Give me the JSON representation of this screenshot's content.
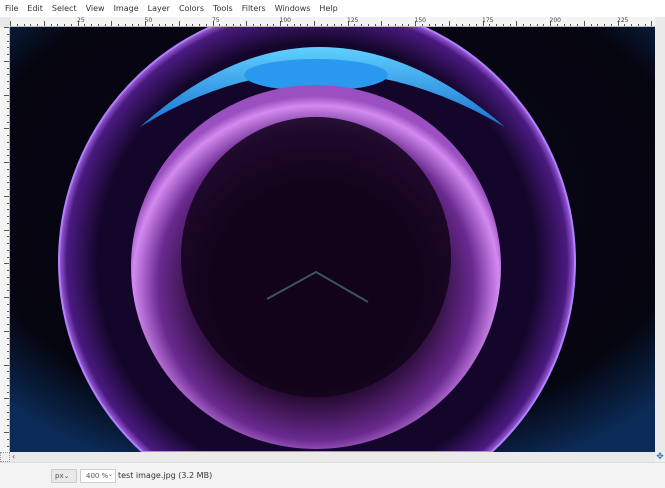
{
  "menu": [
    "File",
    "Edit",
    "Select",
    "View",
    "Image",
    "Layer",
    "Colors",
    "Tools",
    "Filters",
    "Windows",
    "Help"
  ],
  "ruler_labels": [
    "25",
    "50",
    "75",
    "100",
    "125",
    "150",
    "175",
    "200",
    "225"
  ],
  "status": {
    "unit": "px",
    "zoom": "400 %",
    "file_info": "test image.jpg (3.2 MB)"
  },
  "icons": {
    "nav": "navigate-icon",
    "quickmask": "quick-mask-icon"
  }
}
